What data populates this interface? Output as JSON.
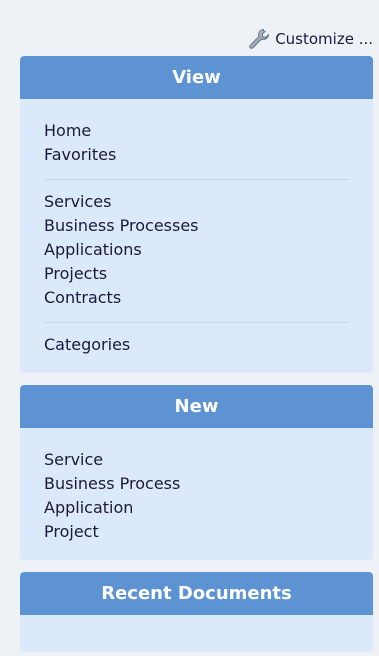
{
  "customize": {
    "label": "Customize ...",
    "icon": "wrench-icon"
  },
  "colors": {
    "header_bg": "#5d93d2",
    "panel_bg": "#dbe9fb",
    "page_bg": "#eef2f7",
    "link_text": "#1a1a3a"
  },
  "panels": {
    "view": {
      "title": "View",
      "groups": [
        [
          "Home",
          "Favorites"
        ],
        [
          "Services",
          "Business Processes",
          "Applications",
          "Projects",
          "Contracts"
        ],
        [
          "Categories"
        ]
      ]
    },
    "new": {
      "title": "New",
      "items": [
        "Service",
        "Business Process",
        "Application",
        "Project"
      ]
    },
    "recent": {
      "title": "Recent Documents",
      "items": []
    }
  }
}
